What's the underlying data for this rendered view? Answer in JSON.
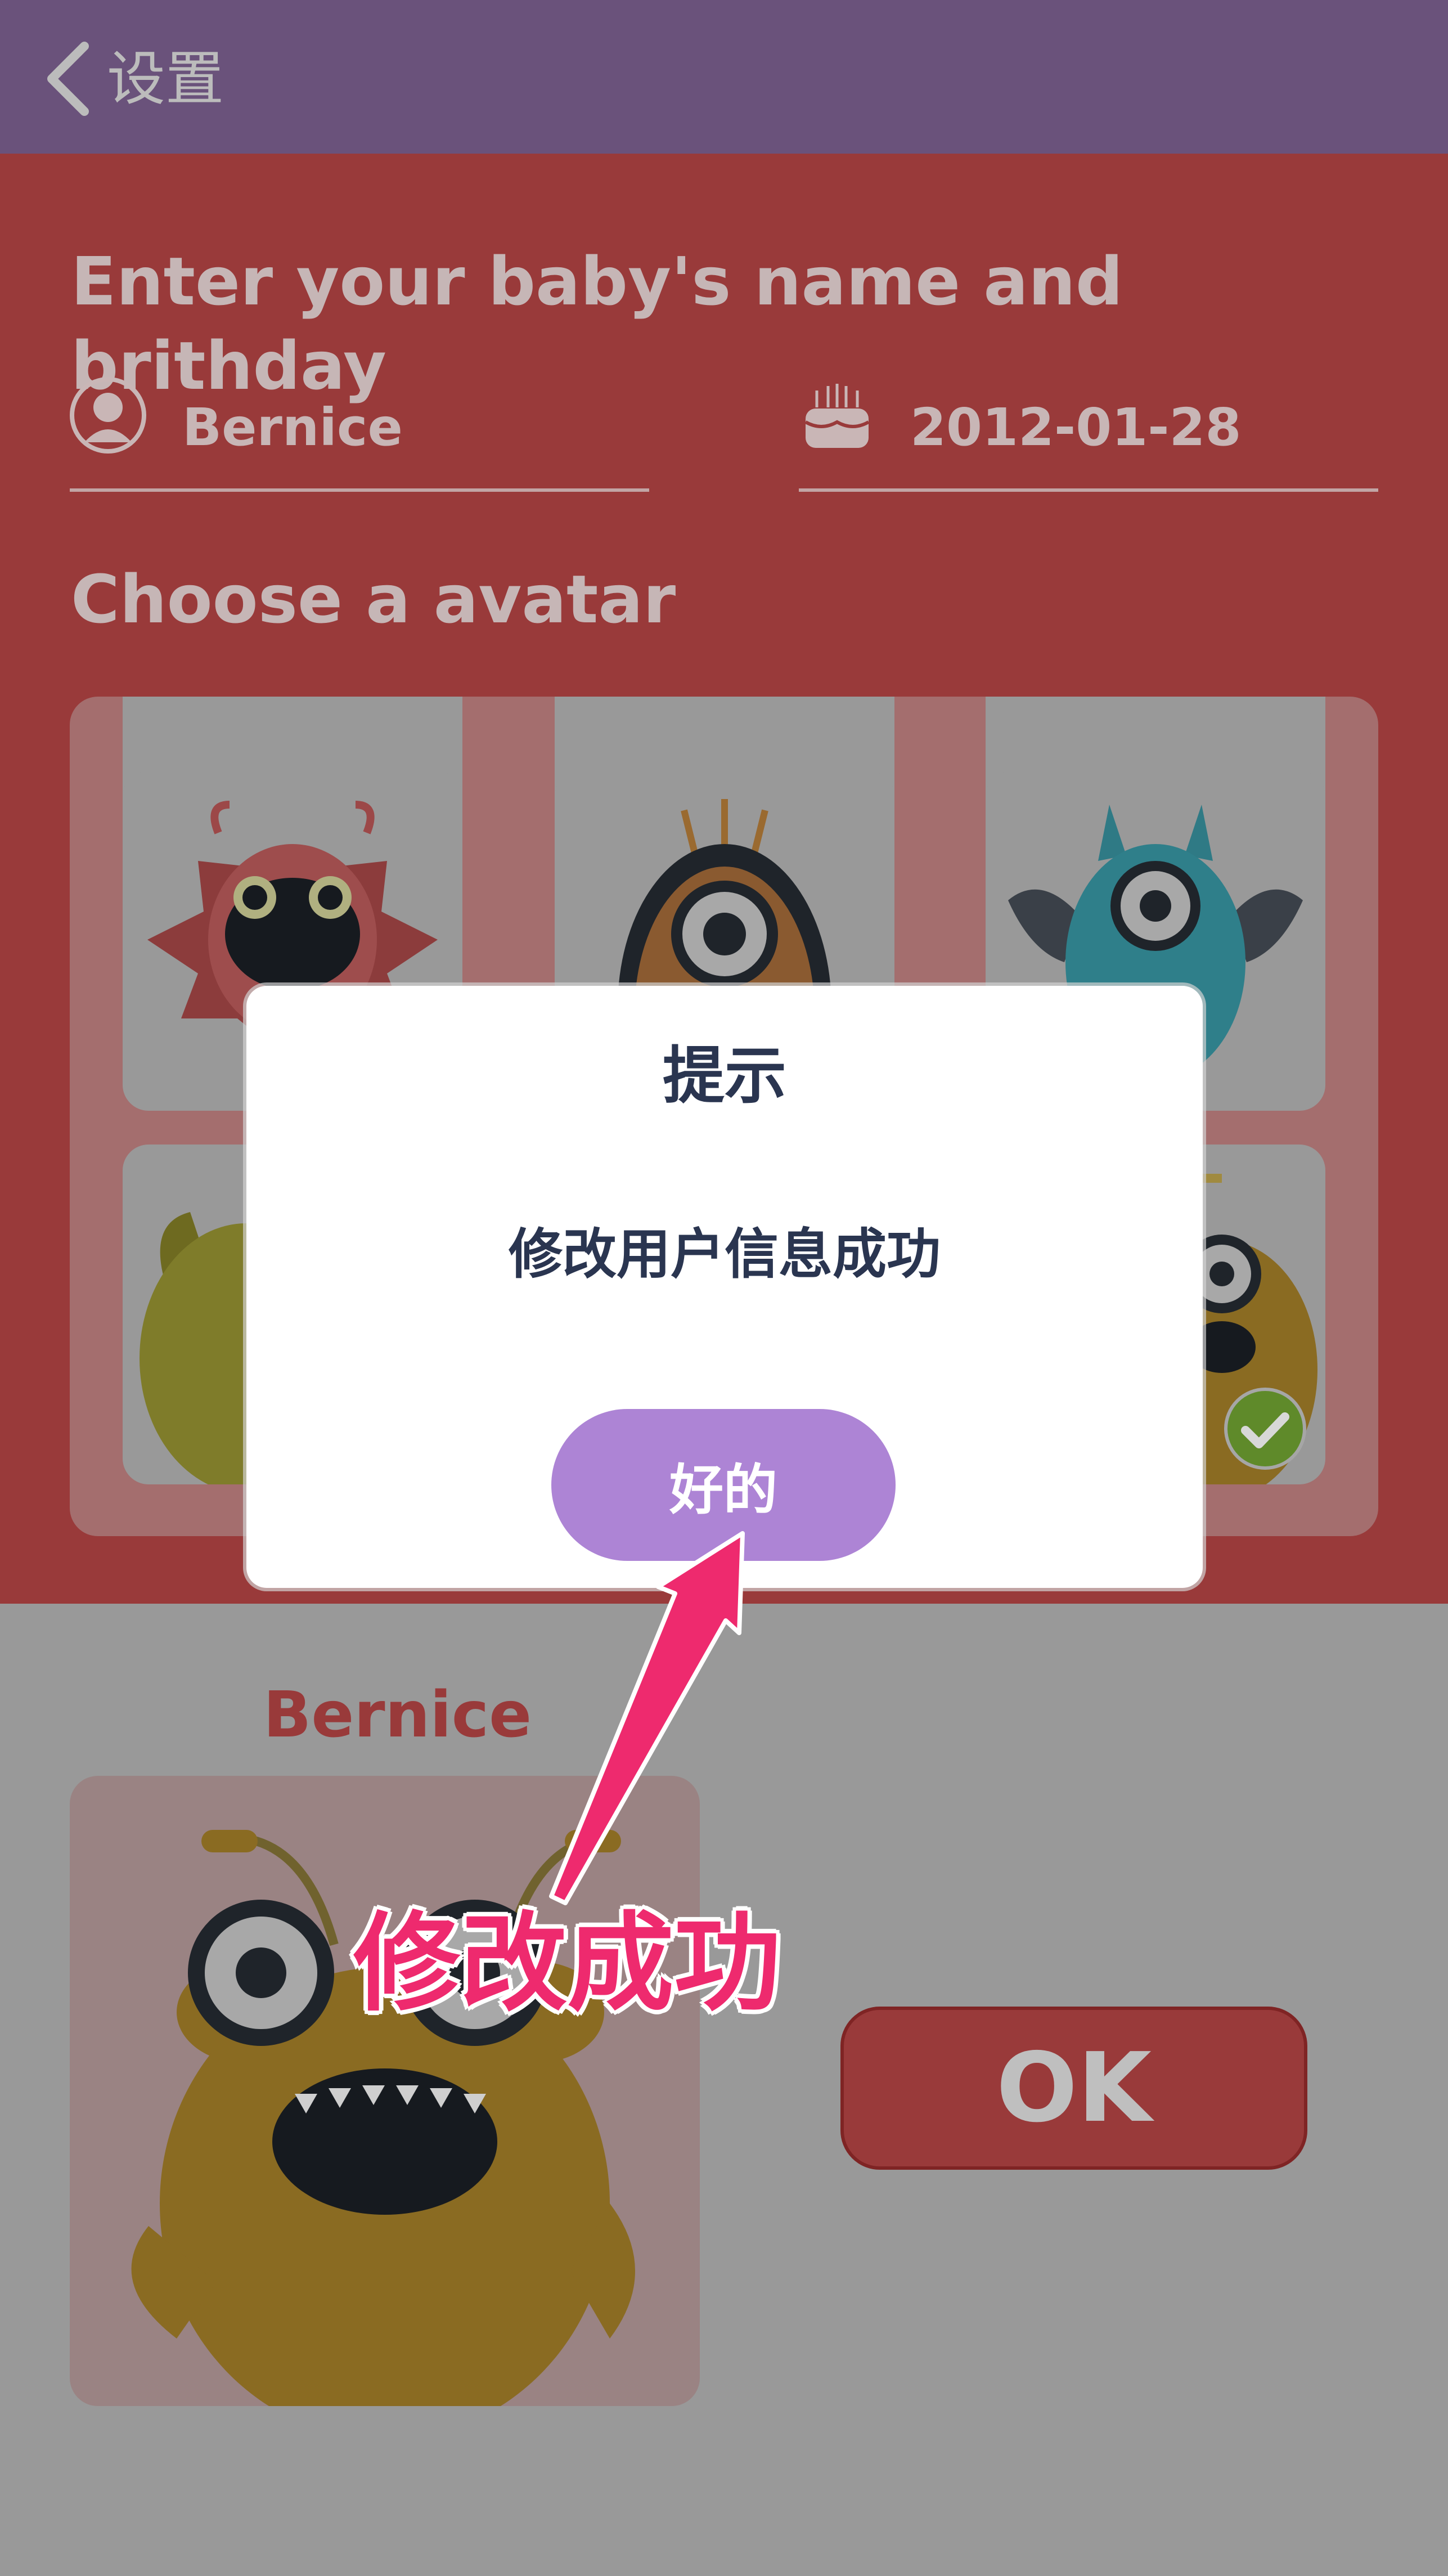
{
  "topbar": {
    "back_label": "设置"
  },
  "form": {
    "name_title": "Enter your baby's name and brithday",
    "name_value": "Bernice",
    "birthday_value": "2012-01-28",
    "avatar_title": "Choose a avatar"
  },
  "preview": {
    "name": "Bernice"
  },
  "ok_button": "OK",
  "dialog": {
    "title": "提示",
    "message": "修改用户信息成功",
    "button": "好的"
  },
  "annotation": {
    "text": "修改成功",
    "color": "#ee2a6e"
  },
  "colors": {
    "topbar": "#6a527b",
    "red": "#993a3a",
    "dialog_button": "#ad84d5"
  },
  "icons": [
    "back-chevron-icon",
    "user-icon",
    "cake-icon",
    "check-icon"
  ]
}
